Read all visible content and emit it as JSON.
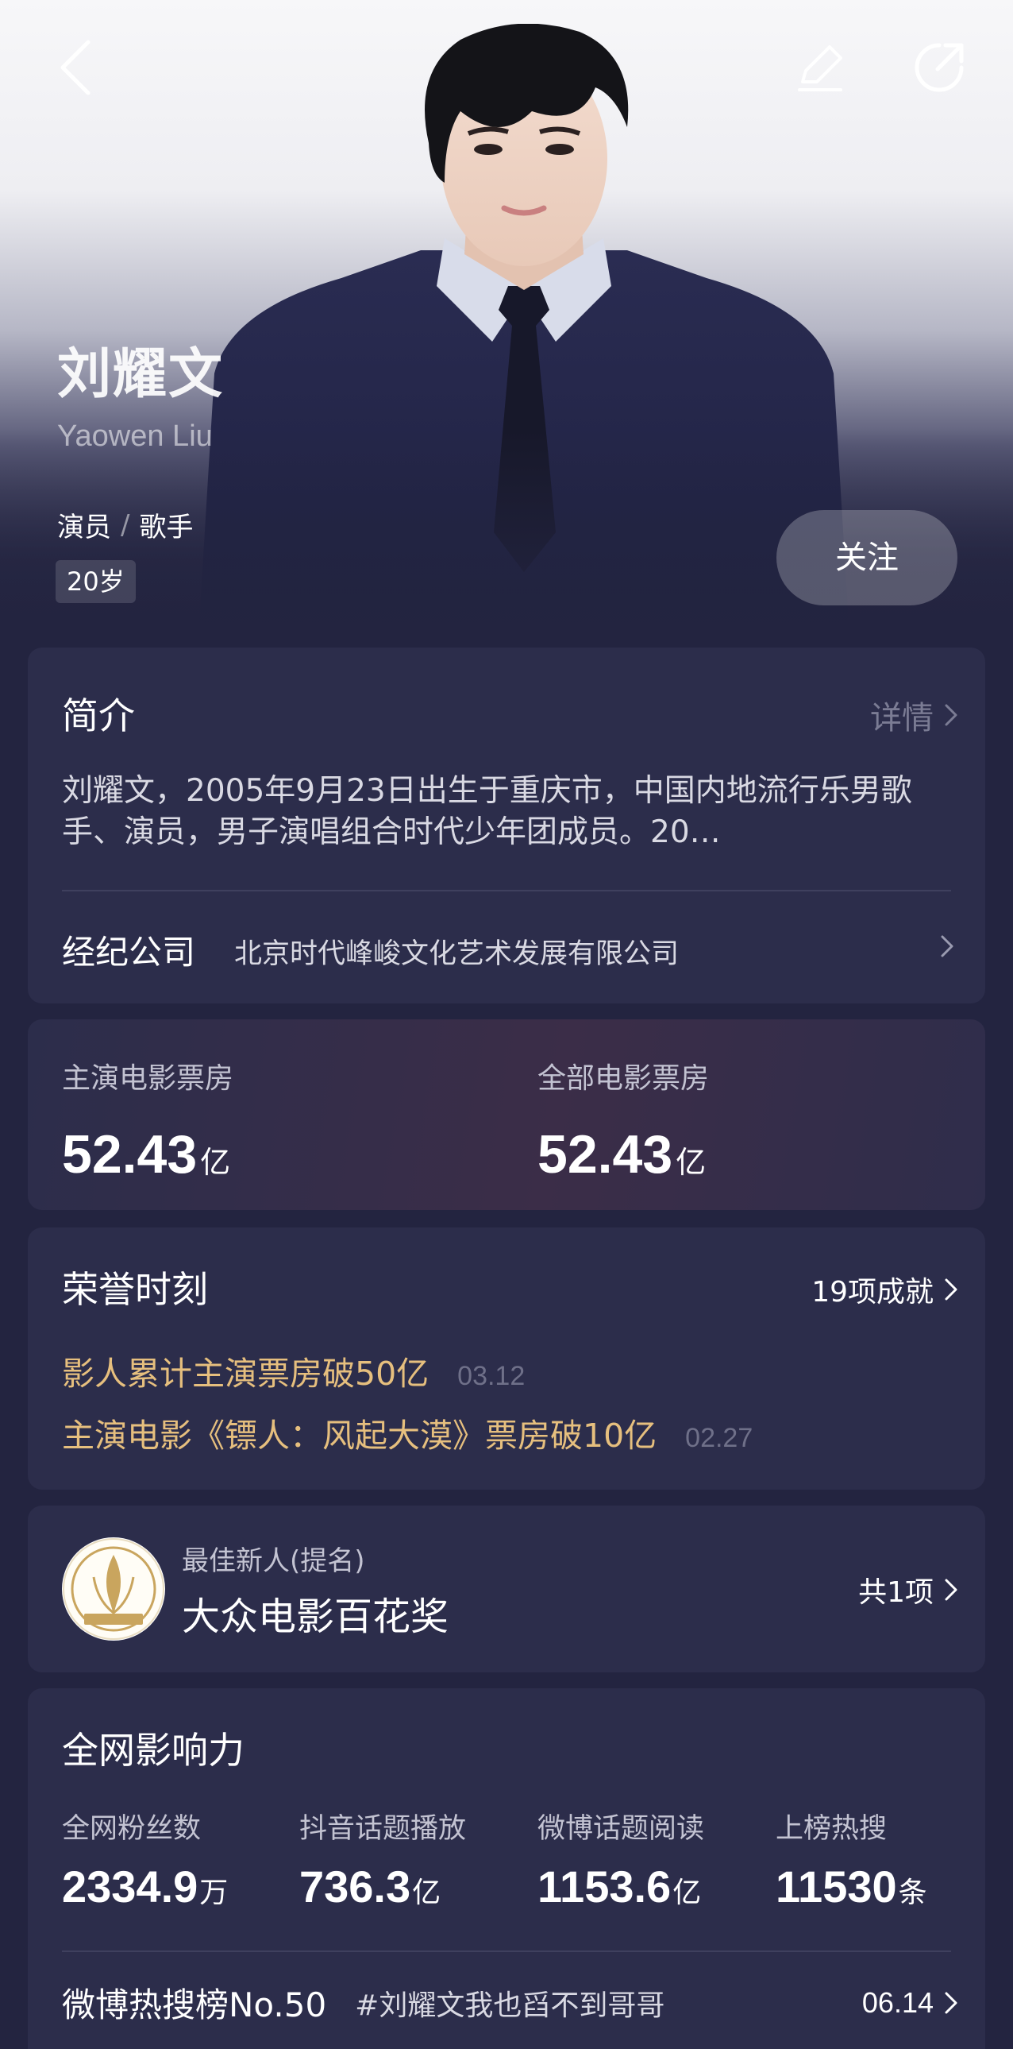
{
  "profile": {
    "name_cn": "刘耀文",
    "name_en": "Yaowen Liu",
    "roles": [
      "演员",
      "歌手"
    ],
    "role_separator": "/",
    "age": "20岁",
    "follow_label": "关注"
  },
  "intro": {
    "title": "简介",
    "detail_label": "详情",
    "text": "刘耀文，2005年9月23日出生于重庆市，中国内地流行乐男歌手、演员，男子演唱组合时代少年团成员。20…",
    "agency_label": "经纪公司",
    "agency_value": "北京时代峰峻文化艺术发展有限公司"
  },
  "box_office": {
    "lead": {
      "label": "主演电影票房",
      "value": "52.43",
      "unit": "亿"
    },
    "all": {
      "label": "全部电影票房",
      "value": "52.43",
      "unit": "亿"
    }
  },
  "honors": {
    "title": "荣誉时刻",
    "count_label": "19项成就",
    "items": [
      {
        "text": "影人累计主演票房破50亿",
        "date": "03.12"
      },
      {
        "text": "主演电影《镖人：风起大漠》票房破10亿",
        "date": "02.27"
      }
    ]
  },
  "award": {
    "category": "最佳新人(提名)",
    "name": "大众电影百花奖",
    "count_label": "共1项",
    "logo_text": "大众电影百花奖"
  },
  "influence": {
    "title": "全网影响力",
    "stats": [
      {
        "label": "全网粉丝数",
        "value": "2334.9",
        "unit": "万"
      },
      {
        "label": "抖音话题播放",
        "value": "736.3",
        "unit": "亿"
      },
      {
        "label": "微博话题阅读",
        "value": "1153.6",
        "unit": "亿"
      },
      {
        "label": "上榜热搜",
        "value": "11530",
        "unit": "条"
      }
    ],
    "hot_search": {
      "rank": "微博热搜榜No.50",
      "topic": "#刘耀文我也舀不到哥哥",
      "date": "06.14"
    }
  },
  "colors": {
    "background": "#232440",
    "card": "#2c2d4b",
    "honor_gold": "#e6bf7e",
    "muted": "#7b7c94"
  }
}
